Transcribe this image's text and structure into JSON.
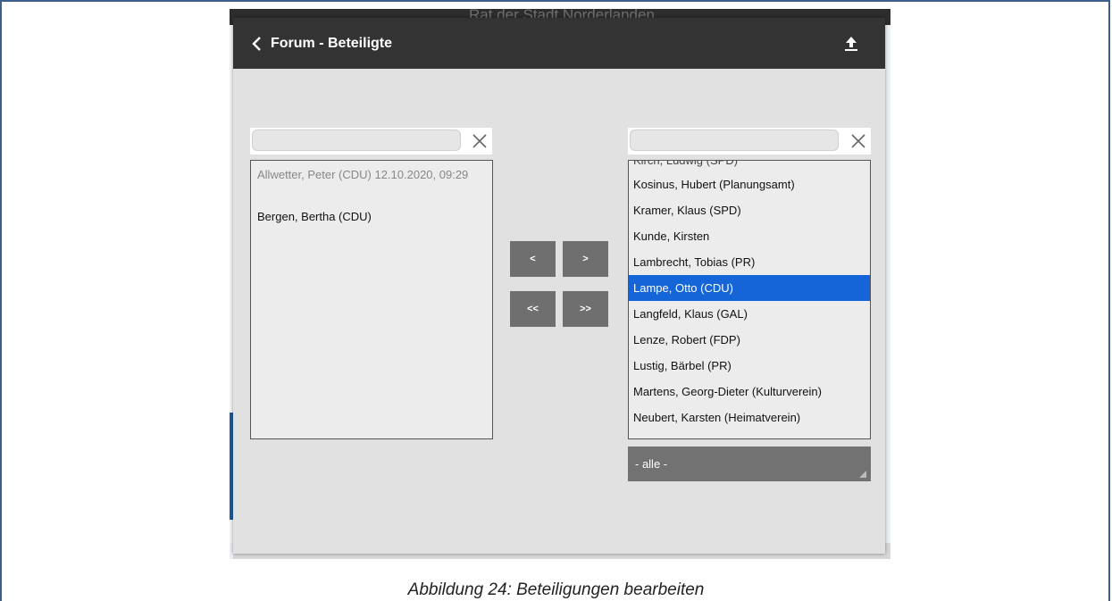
{
  "background_app": {
    "title": "Rat der Stadt Norderlanden"
  },
  "dialog": {
    "title": "Forum - Beteiligte",
    "back_icon": "chevron-left-icon",
    "upload_icon": "upload-icon"
  },
  "left_panel": {
    "search_value": "",
    "items": [
      {
        "label": "Allwetter, Peter (CDU) 12.10.2020, 09:29",
        "muted": true
      },
      {
        "label": "Bergen, Bertha (CDU)",
        "muted": false
      }
    ]
  },
  "right_panel": {
    "search_value": "",
    "partial_item": "Kirch, Ludwig (SPD)",
    "items": [
      "Kosinus, Hubert (Planungsamt)",
      "Kramer, Klaus (SPD)",
      "Kunde, Kirsten",
      "Lambrecht, Tobias (PR)",
      "Lampe, Otto (CDU)",
      "Langfeld, Klaus (GAL)",
      "Lenze, Robert (FDP)",
      "Lustig, Bärbel (PR)",
      "Martens, Georg-Dieter (Kulturverein)",
      "Neubert, Karsten (Heimatverein)"
    ],
    "selected_index": 4,
    "filter": "- alle -"
  },
  "move_buttons": {
    "left_one": "<",
    "right_one": ">",
    "left_all": "<<",
    "right_all": ">>"
  },
  "caption": "Abbildung 24: Beteiligungen bearbeiten",
  "colors": {
    "header": "#333333",
    "selection": "#1565d8",
    "button": "#6f6f6f",
    "frame": "#3c5f8c"
  }
}
